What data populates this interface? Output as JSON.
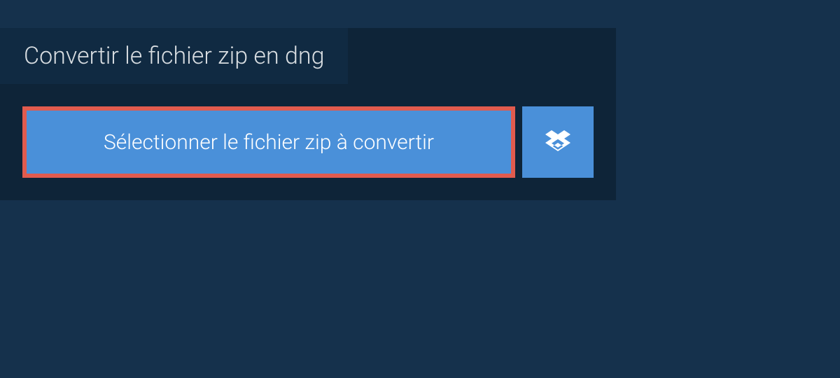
{
  "tab": {
    "title": "Convertir le fichier zip en dng"
  },
  "actions": {
    "select_file_label": "Sélectionner le fichier zip à convertir"
  }
}
